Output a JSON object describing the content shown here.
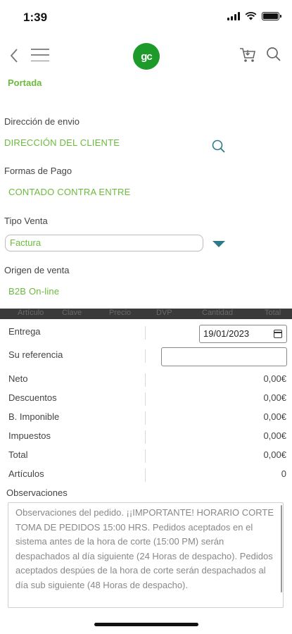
{
  "status": {
    "time": "1:39"
  },
  "nav": {
    "logo_text": "gc",
    "back_icon": "chevron-left-icon",
    "menu_icon": "hamburger-icon",
    "cart_icon": "cart-icon",
    "search_icon": "search-icon"
  },
  "breadcrumb": "Portada",
  "shipping": {
    "label": "Dirección de envio",
    "value": "DIRECCIÓN DEL CLIENTE"
  },
  "payment": {
    "label": "Formas de Pago",
    "value": "CONTADO CONTRA ENTRE"
  },
  "sale_type": {
    "label": "Tipo Venta",
    "selected": "Factura"
  },
  "sale_origin": {
    "label": "Origen de venta",
    "value": "B2B On-line"
  },
  "table_header": [
    "Artículo",
    "Clave",
    "Precio",
    "DVP",
    "Cantidad",
    "Total"
  ],
  "order": {
    "delivery_label": "Entrega",
    "delivery_date": "19/01/2023",
    "reference_label": "Su referencia",
    "reference_value": "",
    "totals": [
      {
        "label": "Neto",
        "value": "0,00€"
      },
      {
        "label": "Descuentos",
        "value": "0,00€"
      },
      {
        "label": "B. Imponible",
        "value": "0,00€"
      },
      {
        "label": "Impuestos",
        "value": "0,00€"
      },
      {
        "label": "Total",
        "value": "0,00€"
      },
      {
        "label": "Artículos",
        "value": "0"
      }
    ]
  },
  "observations": {
    "label": "Observaciones",
    "text": "Observaciones del pedido.  ¡¡IMPORTANTE!  HORARIO CORTE TOMA DE PEDIDOS 15:00 HRS. Pedidos aceptados en el sistema antes de la hora de corte (15:00 PM) serán despachados al día siguiente (24 Horas de despacho). Pedidos aceptados despúes de la hora de corte serán despachados al día sub siguiente (48 Horas de despacho)."
  },
  "colors": {
    "accent_green": "#6cba3c",
    "logo_green": "#1e9a2b",
    "arrow_teal": "#2f7a8a"
  }
}
